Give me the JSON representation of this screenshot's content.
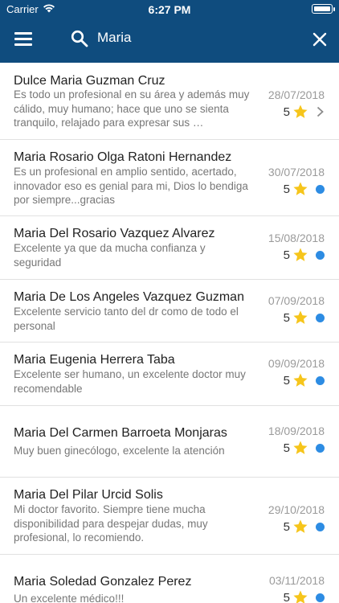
{
  "status": {
    "carrier": "Carrier",
    "time": "6:27 PM"
  },
  "search": {
    "query": "Maria"
  },
  "colors": {
    "header": "#0f4c7e",
    "star": "#f6c51b",
    "unread_dot": "#2d8ce3"
  },
  "reviews": [
    {
      "name": "Dulce Maria Guzman Cruz",
      "comment": "Es todo un profesional en su área y además muy cálido, muy humano; hace que uno se sienta tranquilo, relajado para expresar sus …",
      "date": "28/07/2018",
      "rating": "5",
      "indicator": "chevron"
    },
    {
      "name": "Maria Rosario Olga Ratoni Hernandez",
      "comment": "Es un profesional en amplio sentido, acertado, innovador eso es genial para mi, Dios lo bendiga por siempre...gracias",
      "date": "30/07/2018",
      "rating": "5",
      "indicator": "dot"
    },
    {
      "name": "Maria Del Rosario Vazquez Alvarez",
      "comment": "Excelente  ya que da mucha confianza y seguridad",
      "date": "15/08/2018",
      "rating": "5",
      "indicator": "dot"
    },
    {
      "name": "Maria De Los Angeles Vazquez Guzman",
      "comment": "Excelente servicio tanto del dr como de todo el personal",
      "date": "07/09/2018",
      "rating": "5",
      "indicator": "dot"
    },
    {
      "name": "Maria Eugenia Herrera Taba",
      "comment": "Excelente ser humano, un excelente doctor muy recomendable",
      "date": "09/09/2018",
      "rating": "5",
      "indicator": "dot"
    },
    {
      "name": "Maria Del Carmen Barroeta Monjaras",
      "comment": "Muy buen ginecólogo, excelente la atención",
      "date": "18/09/2018",
      "rating": "5",
      "indicator": "dot"
    },
    {
      "name": "Maria Del Pilar Urcid Solis",
      "comment": "Mi doctor favorito. Siempre tiene mucha disponibilidad para despejar dudas, muy profesional, lo recomiendo.",
      "date": "29/10/2018",
      "rating": "5",
      "indicator": "dot"
    },
    {
      "name": "Maria Soledad Gonzalez Perez",
      "comment": "Un excelente médico!!!",
      "date": "03/11/2018",
      "rating": "5",
      "indicator": "dot"
    }
  ]
}
